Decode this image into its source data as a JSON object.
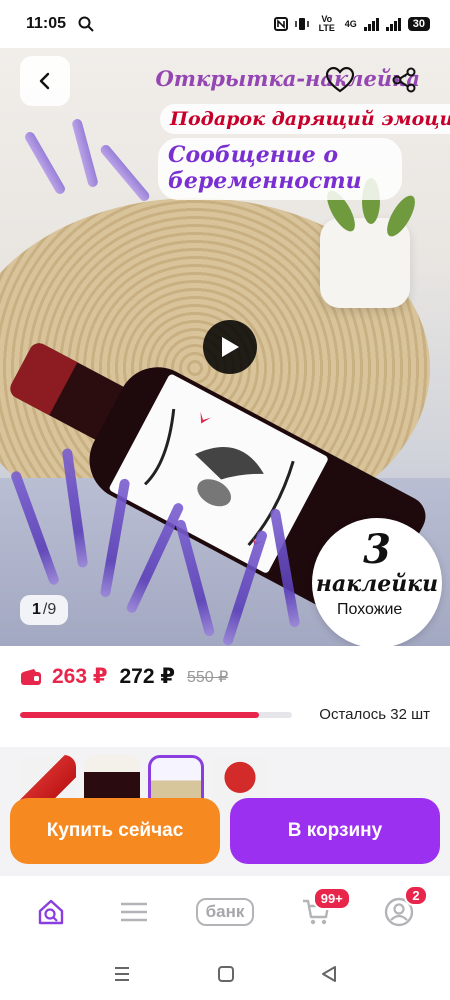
{
  "status_bar": {
    "time": "11:05",
    "network": "Vo LTE",
    "net_type": "4G",
    "battery": "30"
  },
  "hero": {
    "title_line1": "Открытка-наклейка",
    "title_line2": "Подарок дарящий эмоции!",
    "title_line3": "Сообщение о беременности",
    "badge_number": "3",
    "badge_word": "наклейки",
    "counter_current": "1",
    "counter_total": "/9",
    "similar_label": "Похожие"
  },
  "pricing": {
    "card_price": "263 ₽",
    "price": "272 ₽",
    "old_price": "550 ₽",
    "stock_label": "Осталось 32 шт",
    "stock_fraction": 0.88
  },
  "actions": {
    "buy_now": "Купить сейчас",
    "add_to_cart": "В корзину"
  },
  "bottom_nav": {
    "bank_label": "банк",
    "cart_badge": "99+",
    "profile_badge": "2"
  },
  "colors": {
    "accent_red": "#e8254a",
    "buy_orange": "#f6891f",
    "cart_purple": "#9b30f0"
  }
}
